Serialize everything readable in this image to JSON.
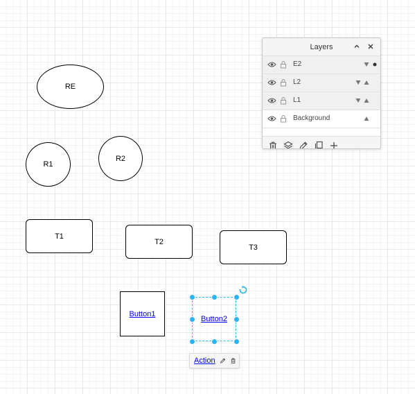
{
  "canvas": {
    "shapes": {
      "re": "RE",
      "r1": "R1",
      "r2": "R2",
      "t1": "T1",
      "t2": "T2",
      "t3": "T3",
      "button1": "Button1",
      "button2": "Button2"
    },
    "selection": {
      "selected_shape": "Button2",
      "accent_color": "#29b6f2"
    }
  },
  "action_bar": {
    "link_label": "Action",
    "icons": [
      "pencil-icon",
      "trash-icon"
    ]
  },
  "layers_panel": {
    "title": "Layers",
    "header_icons": [
      "collapse-chevron-up-icon",
      "close-icon"
    ],
    "layers": [
      {
        "name": "E2",
        "controls": [
          "move-down",
          "current-dot"
        ]
      },
      {
        "name": "L2",
        "controls": [
          "move-down",
          "move-up"
        ]
      },
      {
        "name": "L1",
        "controls": [
          "move-down",
          "move-up"
        ]
      },
      {
        "name": "Background",
        "controls": [
          "move-up"
        ]
      }
    ],
    "active_layer": "Background",
    "toolbar_icons": [
      "trash-icon",
      "layers-icon",
      "pencil-icon",
      "duplicate-icon",
      "plus-icon"
    ]
  }
}
